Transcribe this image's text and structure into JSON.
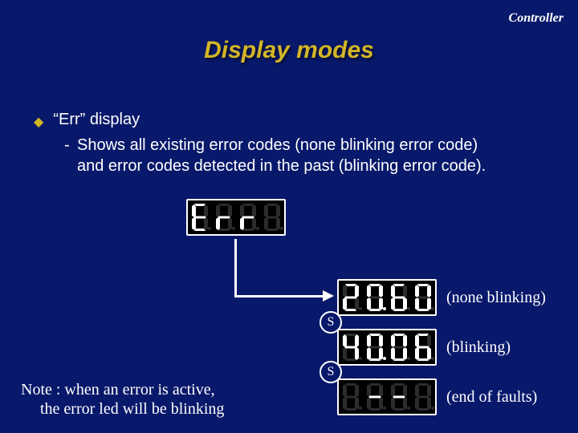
{
  "header": "Controller",
  "title": "Display modes",
  "bullet": "“Err” display",
  "sub_text": "Shows all existing error codes (none blinking error code) and error codes detected in the past (blinking error code).",
  "note_line1": "Note :  when an error is active,",
  "note_line2": "the error led will be blinking",
  "annotations": {
    "none_blinking": "(none blinking)",
    "blinking": "(blinking)",
    "end": "(end of faults)"
  },
  "s_badge": "S",
  "panels": {
    "err": {
      "digits": [
        "E",
        "r",
        "r",
        "off"
      ],
      "lit_dots": []
    },
    "p1": {
      "digits": [
        "2",
        "0",
        "6",
        "0"
      ],
      "lit_dots": [
        1
      ]
    },
    "p2": {
      "digits": [
        "4",
        "0",
        "0",
        "6"
      ],
      "lit_dots": [
        1
      ]
    },
    "p3": {
      "digits": [
        "off",
        "-",
        "-",
        "off"
      ],
      "lit_dots": []
    }
  },
  "colors": {
    "seg_on": "#ffffff",
    "seg_off": "#2c2c2c"
  }
}
